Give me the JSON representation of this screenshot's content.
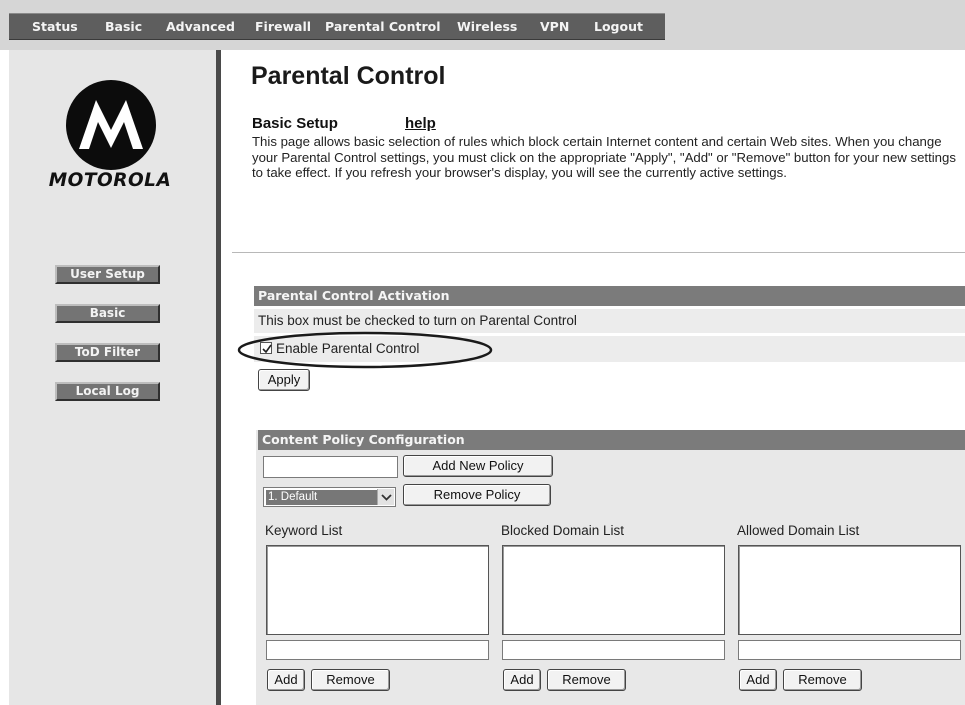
{
  "nav": {
    "items": [
      "Status",
      "Basic",
      "Advanced",
      "Firewall",
      "Parental Control",
      "Wireless",
      "VPN",
      "Logout"
    ]
  },
  "brand": {
    "wordmark": "MOTOROLA"
  },
  "sidebar": {
    "items": [
      "User Setup",
      "Basic",
      "ToD Filter",
      "Local Log"
    ]
  },
  "main": {
    "title": "Parental Control",
    "subtitle": "Basic Setup",
    "help_link": "help",
    "description": "This page allows basic selection of rules which block certain Internet content and certain Web sites. When you change your Parental Control settings, you must click on the appropriate \"Apply\", \"Add\" or \"Remove\" button for your new settings to take effect. If you refresh your browser's display, you will see the currently active settings."
  },
  "activation": {
    "header": "Parental Control Activation",
    "note": "This box must be checked to turn on Parental Control",
    "checkbox_label": "Enable Parental Control",
    "checkbox_checked": true,
    "apply_label": "Apply"
  },
  "content_policy": {
    "header": "Content Policy Configuration",
    "new_policy_value": "",
    "add_policy_label": "Add New Policy",
    "selected_policy": "1. Default",
    "remove_policy_label": "Remove Policy",
    "lists": [
      {
        "label": "Keyword List",
        "add_label": "Add",
        "remove_label": "Remove"
      },
      {
        "label": "Blocked Domain List",
        "add_label": "Add",
        "remove_label": "Remove"
      },
      {
        "label": "Allowed Domain List",
        "add_label": "Add",
        "remove_label": "Remove"
      }
    ]
  }
}
